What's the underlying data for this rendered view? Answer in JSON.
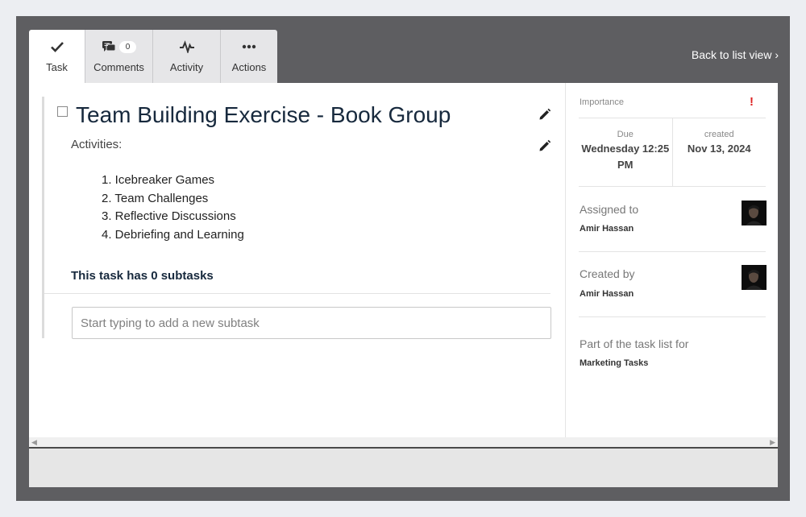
{
  "tabs": [
    {
      "label": "Task",
      "icon": "check-icon",
      "active": true
    },
    {
      "label": "Comments",
      "icon": "comments-icon",
      "badge": "0"
    },
    {
      "label": "Activity",
      "icon": "activity-icon"
    },
    {
      "label": "Actions",
      "icon": "more-icon"
    }
  ],
  "header": {
    "back_label": "Back to list view ›"
  },
  "task": {
    "title": "Team Building Exercise - Book Group",
    "description_label": "Activities:",
    "activities": [
      "1. Icebreaker Games",
      "2. Team Challenges",
      "3. Reflective Discussions",
      "4. Debriefing and Learning"
    ],
    "subtask_count_text": "This task has 0 subtasks",
    "subtask_placeholder": "Start typing to add a new subtask"
  },
  "side": {
    "importance_label": "Importance",
    "importance_mark": "!",
    "due_label": "Due",
    "due_value": "Wednesday 12:25 PM",
    "created_label": "created",
    "created_value": "Nov 13, 2024",
    "assigned_label": "Assigned to",
    "assigned_name": "Amir Hassan",
    "created_by_label": "Created by",
    "created_by_name": "Amir Hassan",
    "list_label": "Part of the task list for",
    "list_name": "Marketing Tasks"
  },
  "colors": {
    "frame": "#5e5e61",
    "title": "#17293d",
    "importance": "#dd2222"
  }
}
